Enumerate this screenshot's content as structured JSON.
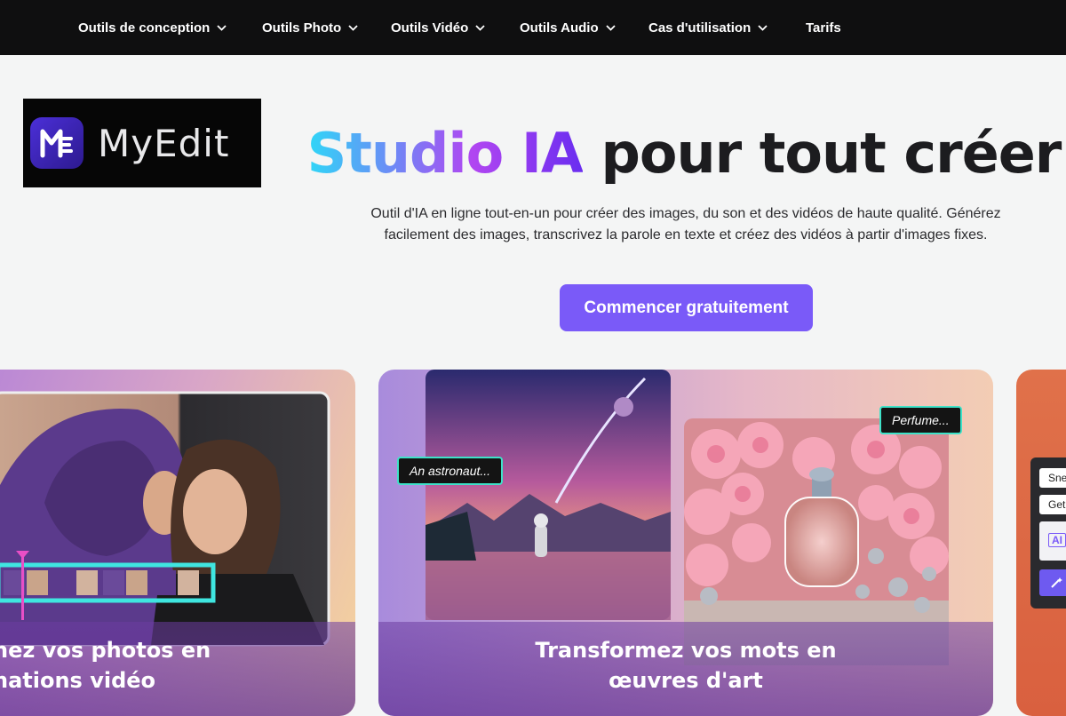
{
  "nav": {
    "items": [
      {
        "label": "Outils de conception",
        "has_dropdown": true
      },
      {
        "label": "Outils Photo",
        "has_dropdown": true
      },
      {
        "label": "Outils Vidéo",
        "has_dropdown": true
      },
      {
        "label": "Outils Audio",
        "has_dropdown": true
      },
      {
        "label": "Cas d'utilisation",
        "has_dropdown": true
      },
      {
        "label": "Tarifs",
        "has_dropdown": false
      }
    ]
  },
  "logo": {
    "text": "MyEdit",
    "icon": "myedit-logo-icon"
  },
  "hero": {
    "title_highlight": "Studio IA",
    "title_rest": " pour tout créer",
    "subtitle_line1": "Outil d'IA en ligne tout-en-un pour créer des images, du son et des vidéos de haute qualité. Générez",
    "subtitle_line2": "facilement des images, transcrivez la parole en texte et créez des vidéos à partir d'images fixes.",
    "cta_label": "Commencer gratuitement"
  },
  "cards": [
    {
      "title_line1": "nez vos photos en",
      "title_line2": "nations vidéo"
    },
    {
      "title_line1": "Transformez vos mots en",
      "title_line2": "œuvres d'art",
      "tag_left": "An astronaut...",
      "tag_right": "Perfume..."
    },
    {
      "mini_field1": "Sne",
      "mini_field2": "Get",
      "mini_chip": "AI"
    }
  ],
  "colors": {
    "nav_bg": "#0f0f10",
    "cta_bg": "#7a5af8",
    "tag_border": "#3ee2c8",
    "timeline_border": "#3fe6e0"
  }
}
